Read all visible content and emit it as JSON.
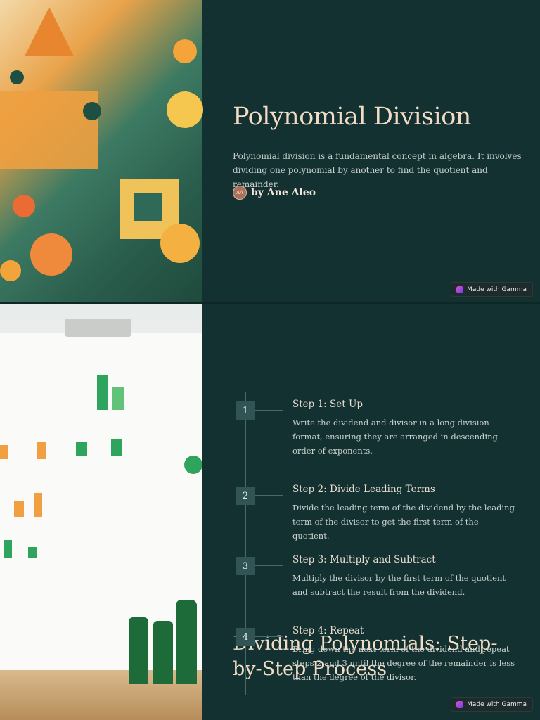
{
  "slide1": {
    "title": "Polynomial Division",
    "description": "Polynomial division is a fundamental concept in algebra. It involves dividing one polynomial by another to find the quotient and remainder.",
    "author_initials": "AA",
    "author": "by Ane Aleo",
    "badge": "Made with Gamma"
  },
  "slide2": {
    "title": "Dividing Polynomials: Step-by-Step Process",
    "badge": "Made with Gamma",
    "steps": [
      {
        "num": "1",
        "title": "Step 1: Set Up",
        "desc": "Write the dividend and divisor in a long division format, ensuring they are arranged in descending order of exponents."
      },
      {
        "num": "2",
        "title": "Step 2: Divide Leading Terms",
        "desc": "Divide the leading term of the dividend by the leading term of the divisor to get the first term of the quotient."
      },
      {
        "num": "3",
        "title": "Step 3: Multiply and Subtract",
        "desc": "Multiply the divisor by the first term of the quotient and subtract the result from the dividend."
      },
      {
        "num": "4",
        "title": "Step 4: Repeat",
        "desc": "Bring down the next term of the dividend and repeat steps 2 and 3 until the degree of the remainder is less than the degree of the divisor."
      }
    ]
  }
}
